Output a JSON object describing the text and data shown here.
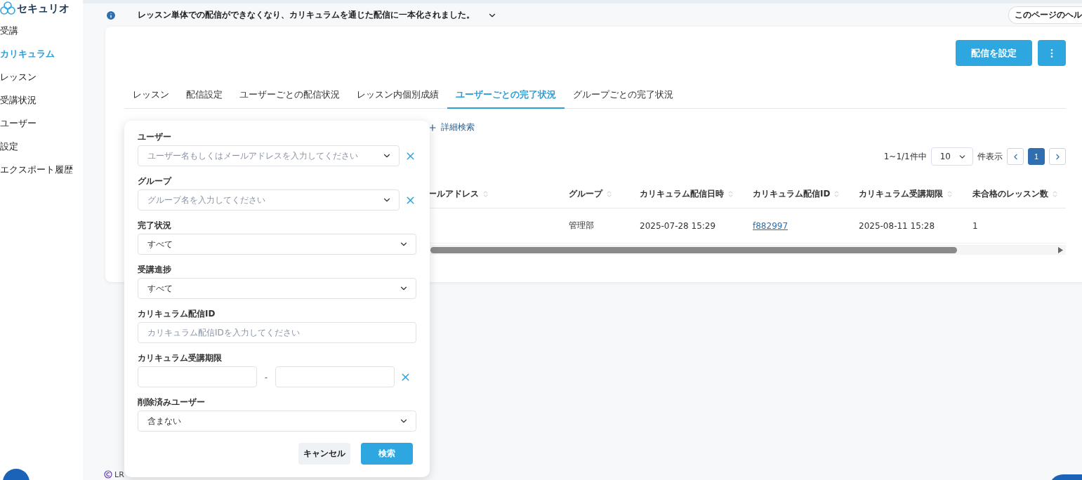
{
  "sidebar": {
    "logo": "セキュリオ",
    "items": [
      {
        "label": "受講",
        "selected": false
      },
      {
        "label": "カリキュラム",
        "selected": true
      },
      {
        "label": "レッスン",
        "selected": false
      },
      {
        "label": "受講状況",
        "selected": false
      },
      {
        "label": "ユーザー",
        "selected": false
      },
      {
        "label": "設定",
        "selected": false
      },
      {
        "label": "エクスポート履歴",
        "selected": false
      }
    ]
  },
  "notice": {
    "text": "レッスン単体での配信ができなくなり、カリキュラムを通じた配信に一本化されました。",
    "help_link": "このページのヘル"
  },
  "actions": {
    "primary": "配信を設定"
  },
  "tabs": [
    {
      "label": "レッスン",
      "selected": false
    },
    {
      "label": "配信設定",
      "selected": false
    },
    {
      "label": "ユーザーごとの配信状況",
      "selected": false
    },
    {
      "label": "レッスン内個別成績",
      "selected": false
    },
    {
      "label": "ユーザーごとの完了状況",
      "selected": true
    },
    {
      "label": "グループごとの完了状況",
      "selected": false
    }
  ],
  "advanced_search": "詳細検索",
  "pagination": {
    "summary": "1~1/1件中",
    "page_size": "10",
    "suffix": "件表示",
    "pages": [
      {
        "label": "1",
        "selected": true
      }
    ]
  },
  "table": {
    "columns": [
      "ールアドレス",
      "グループ",
      "カリキュラム配信日時",
      "カリキュラム配信ID",
      "カリキュラム受講期限",
      "未合格のレッスン数"
    ],
    "rows": [
      {
        "cells": [
          "",
          "管理部",
          "2025-07-28 15:29",
          "f882997",
          "2025-08-11 15:28",
          "1"
        ]
      }
    ]
  },
  "filter_panel": {
    "fields": [
      {
        "kind": "select",
        "label": "ユーザー",
        "placeholder": "ユーザー名もしくはメールアドレスを入力してください",
        "clearable": true
      },
      {
        "kind": "select",
        "label": "グループ",
        "placeholder": "グループ名を入力してください",
        "clearable": true
      },
      {
        "kind": "select",
        "label": "完了状況",
        "value": "すべて",
        "clearable": false
      },
      {
        "kind": "select",
        "label": "受講進捗",
        "value": "すべて",
        "clearable": false
      },
      {
        "kind": "input",
        "label": "カリキュラム配信ID",
        "placeholder": "カリキュラム配信IDを入力してください",
        "clearable": false
      },
      {
        "kind": "daterange",
        "label": "カリキュラム受講期限",
        "separator": "-",
        "clearable": true
      },
      {
        "kind": "select",
        "label": "削除済みユーザー",
        "value": "含まない",
        "clearable": false
      }
    ],
    "cancel": "キャンセル",
    "submit": "検索"
  },
  "footer": {
    "copyright": "LR"
  }
}
